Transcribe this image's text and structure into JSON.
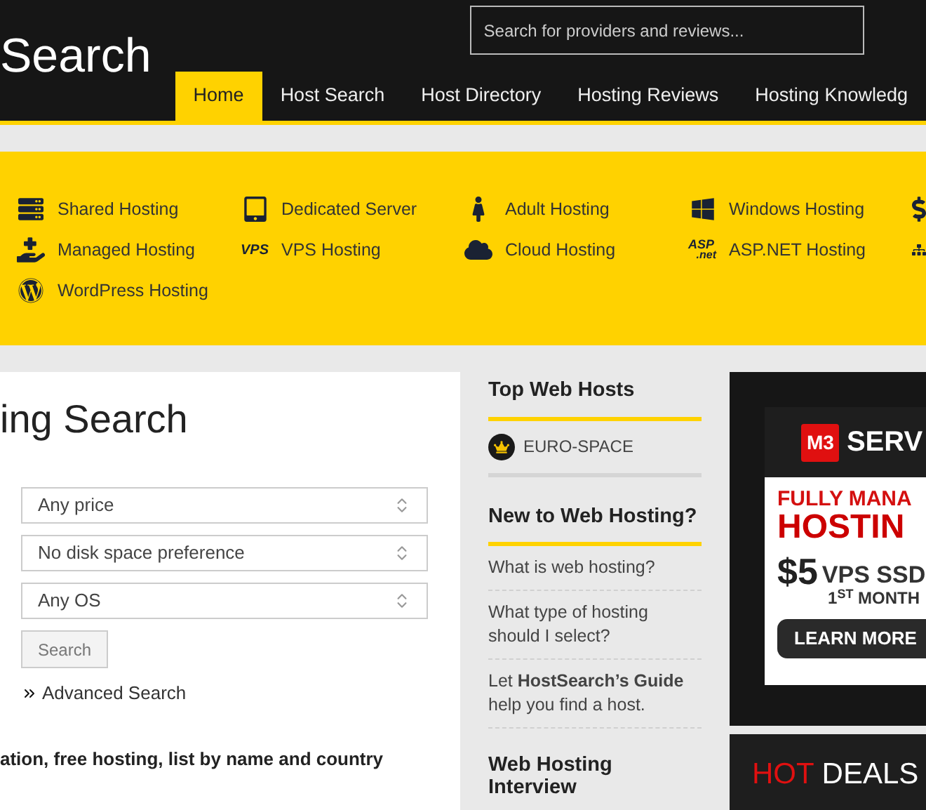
{
  "header": {
    "logo": "Search",
    "search": {
      "placeholder": "Search for providers and reviews..."
    }
  },
  "nav": [
    {
      "label": "Home",
      "selected": true
    },
    {
      "label": "Host Search",
      "selected": false
    },
    {
      "label": "Host Directory",
      "selected": false
    },
    {
      "label": "Hosting Reviews",
      "selected": false
    },
    {
      "label": "Hosting Knowledg",
      "selected": false
    }
  ],
  "categories": [
    [
      {
        "kind": "shared",
        "label": "Shared Hosting"
      },
      {
        "kind": "managed",
        "label": "Managed Hosting"
      },
      {
        "kind": "wordpress",
        "label": "WordPress Hosting"
      }
    ],
    [
      {
        "kind": "dedicated",
        "label": "Dedicated Server"
      },
      {
        "kind": "vps",
        "label": "VPS Hosting",
        "icon_text": "VPS"
      }
    ],
    [
      {
        "kind": "adult",
        "label": "Adult Hosting"
      },
      {
        "kind": "cloud",
        "label": "Cloud Hosting"
      }
    ],
    [
      {
        "kind": "windows",
        "label": "Windows Hosting"
      },
      {
        "kind": "aspnet",
        "label": "ASP.NET Hosting",
        "icon_text": "ASP",
        "icon_subtext": ".net"
      }
    ]
  ],
  "search_panel": {
    "title": "ing Search",
    "selects": [
      "Any price",
      "No disk space preference",
      "Any OS"
    ],
    "button": "Search",
    "advanced_link": "Advanced Search",
    "footer_text": "ation, free hosting, list by name and country"
  },
  "sidebar": {
    "top_hosts": {
      "title": "Top Web Hosts",
      "items": [
        "EURO-SPACE"
      ]
    },
    "new_to_hosting": {
      "title": "New to Web Hosting?",
      "items": [
        "What is web hosting?",
        "What type of hosting should I select?",
        "Let **HostSearch’s Guide** help you find a host."
      ]
    },
    "interview": {
      "title": "Web Hosting Interview"
    }
  },
  "ad": {
    "brand_mark": "M3",
    "brand": "SERV",
    "line_1": "FULLY MANA",
    "line_2": "HOSTIN",
    "price": "$5",
    "product": "VPS SSD",
    "term": "1$^{ST}$ MONTH",
    "button": "LEARN MORE"
  },
  "hot_deals": {
    "hot": "HOT",
    "deals": "DEALS"
  }
}
